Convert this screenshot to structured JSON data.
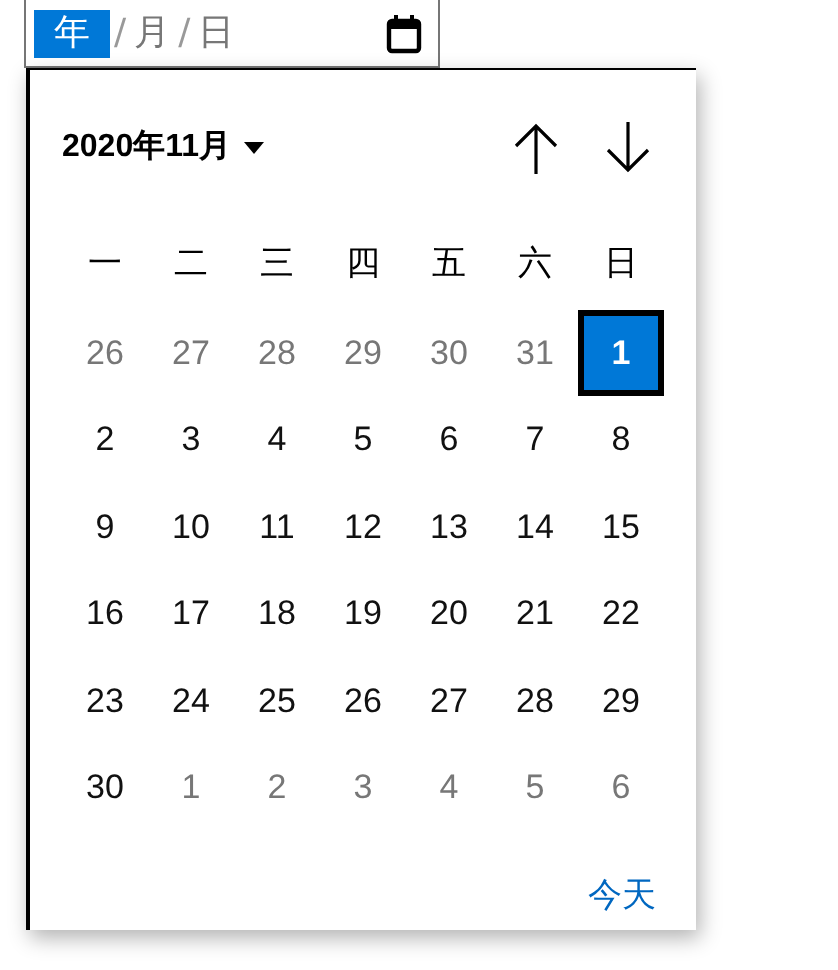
{
  "date_field": {
    "parts": [
      {
        "kind": "segment",
        "text": "年",
        "selected": true
      },
      {
        "kind": "separator",
        "text": "/"
      },
      {
        "kind": "segment",
        "text": "月",
        "selected": false
      },
      {
        "kind": "separator",
        "text": "/"
      },
      {
        "kind": "segment",
        "text": "日",
        "selected": false
      }
    ]
  },
  "calendar": {
    "month_label": "2020年11月",
    "weekdays": [
      "一",
      "二",
      "三",
      "四",
      "五",
      "六",
      "日"
    ],
    "weeks": [
      [
        {
          "day": "26",
          "in_month": false,
          "selected": false
        },
        {
          "day": "27",
          "in_month": false,
          "selected": false
        },
        {
          "day": "28",
          "in_month": false,
          "selected": false
        },
        {
          "day": "29",
          "in_month": false,
          "selected": false
        },
        {
          "day": "30",
          "in_month": false,
          "selected": false
        },
        {
          "day": "31",
          "in_month": false,
          "selected": false
        },
        {
          "day": "1",
          "in_month": true,
          "selected": true
        }
      ],
      [
        {
          "day": "2",
          "in_month": true,
          "selected": false
        },
        {
          "day": "3",
          "in_month": true,
          "selected": false
        },
        {
          "day": "4",
          "in_month": true,
          "selected": false
        },
        {
          "day": "5",
          "in_month": true,
          "selected": false
        },
        {
          "day": "6",
          "in_month": true,
          "selected": false
        },
        {
          "day": "7",
          "in_month": true,
          "selected": false
        },
        {
          "day": "8",
          "in_month": true,
          "selected": false
        }
      ],
      [
        {
          "day": "9",
          "in_month": true,
          "selected": false
        },
        {
          "day": "10",
          "in_month": true,
          "selected": false
        },
        {
          "day": "11",
          "in_month": true,
          "selected": false
        },
        {
          "day": "12",
          "in_month": true,
          "selected": false
        },
        {
          "day": "13",
          "in_month": true,
          "selected": false
        },
        {
          "day": "14",
          "in_month": true,
          "selected": false
        },
        {
          "day": "15",
          "in_month": true,
          "selected": false
        }
      ],
      [
        {
          "day": "16",
          "in_month": true,
          "selected": false
        },
        {
          "day": "17",
          "in_month": true,
          "selected": false
        },
        {
          "day": "18",
          "in_month": true,
          "selected": false
        },
        {
          "day": "19",
          "in_month": true,
          "selected": false
        },
        {
          "day": "20",
          "in_month": true,
          "selected": false
        },
        {
          "day": "21",
          "in_month": true,
          "selected": false
        },
        {
          "day": "22",
          "in_month": true,
          "selected": false
        }
      ],
      [
        {
          "day": "23",
          "in_month": true,
          "selected": false
        },
        {
          "day": "24",
          "in_month": true,
          "selected": false
        },
        {
          "day": "25",
          "in_month": true,
          "selected": false
        },
        {
          "day": "26",
          "in_month": true,
          "selected": false
        },
        {
          "day": "27",
          "in_month": true,
          "selected": false
        },
        {
          "day": "28",
          "in_month": true,
          "selected": false
        },
        {
          "day": "29",
          "in_month": true,
          "selected": false
        }
      ],
      [
        {
          "day": "30",
          "in_month": true,
          "selected": false
        },
        {
          "day": "1",
          "in_month": false,
          "selected": false
        },
        {
          "day": "2",
          "in_month": false,
          "selected": false
        },
        {
          "day": "3",
          "in_month": false,
          "selected": false
        },
        {
          "day": "4",
          "in_month": false,
          "selected": false
        },
        {
          "day": "5",
          "in_month": false,
          "selected": false
        },
        {
          "day": "6",
          "in_month": false,
          "selected": false
        }
      ]
    ],
    "today_button": "今天"
  }
}
